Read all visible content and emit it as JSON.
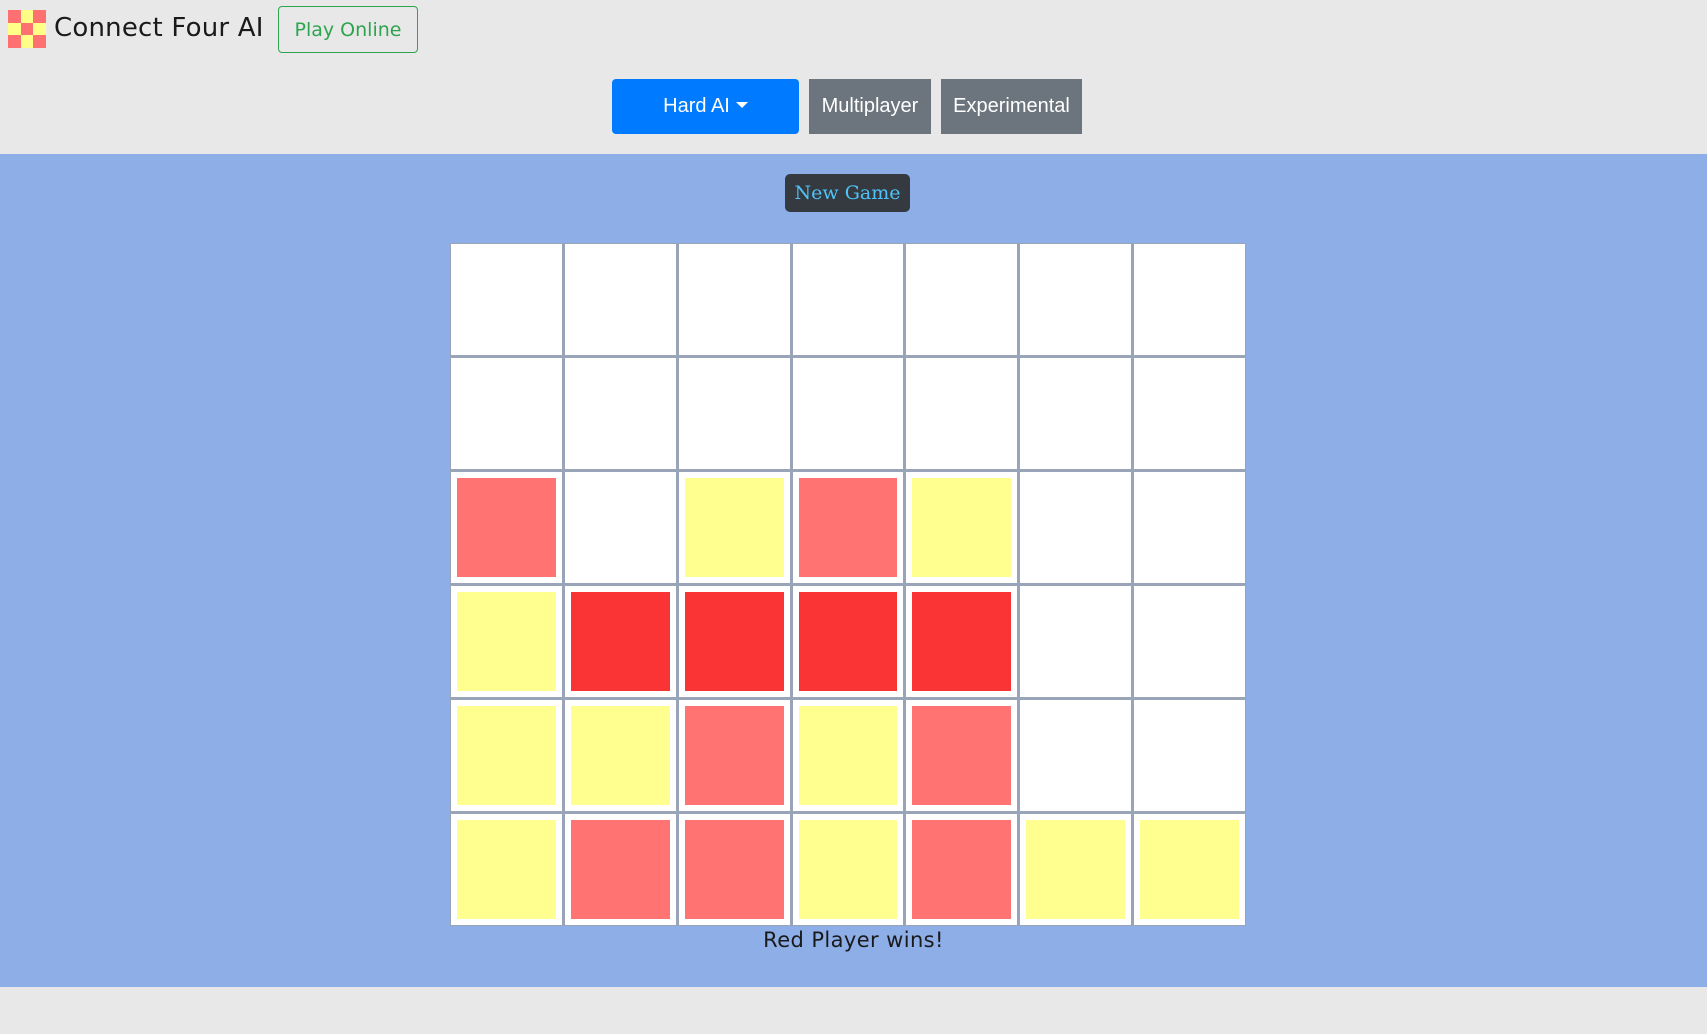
{
  "header": {
    "title": "Connect Four AI",
    "play_online_label": "Play Online",
    "logo_icon": "checker-logo-icon",
    "logo_colors": [
      "#ff7070",
      "#ffff88",
      "#ff7070",
      "#ffff88",
      "#ff7070",
      "#ffff88",
      "#ff7070",
      "#ffff88",
      "#ff7070"
    ]
  },
  "modes": {
    "hard_label": "Hard AI",
    "multiplayer_label": "Multiplayer",
    "experimental_label": "Experimental"
  },
  "game": {
    "new_game_label": "New Game",
    "status": "Red Player wins!",
    "colors": {
      "empty": "#ffffff",
      "red": "#ff7373",
      "yellow": "#ffff8f",
      "red_win": "#fa3434"
    },
    "board": [
      [
        "",
        "",
        "",
        "",
        "",
        "",
        ""
      ],
      [
        "",
        "",
        "",
        "",
        "",
        "",
        ""
      ],
      [
        "red",
        "",
        "yellow",
        "red",
        "yellow",
        "",
        ""
      ],
      [
        "yellow",
        "red_win",
        "red_win",
        "red_win",
        "red_win",
        "",
        ""
      ],
      [
        "yellow",
        "yellow",
        "red",
        "yellow",
        "red",
        "",
        ""
      ],
      [
        "yellow",
        "red",
        "red",
        "yellow",
        "red",
        "yellow",
        "yellow"
      ]
    ]
  }
}
